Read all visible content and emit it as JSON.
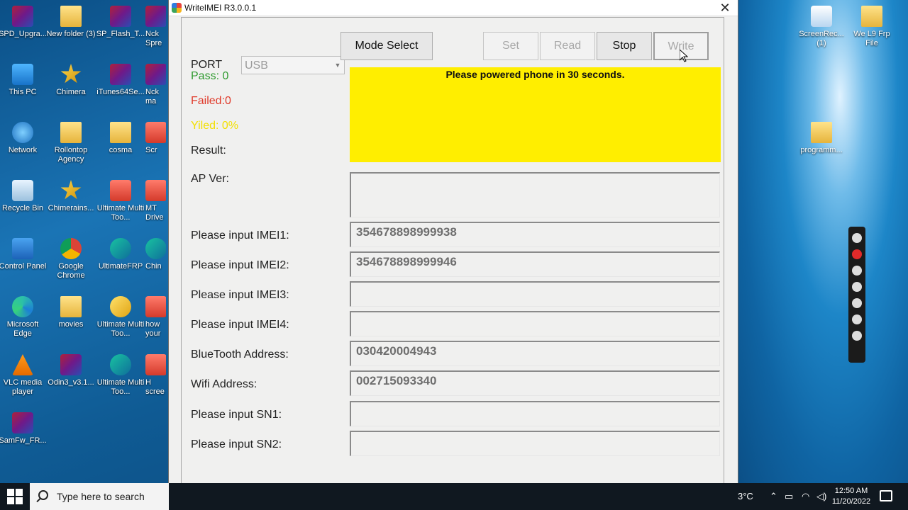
{
  "desktop": {
    "icons": [
      {
        "label": "SPD_Upgra...",
        "type": "rar"
      },
      {
        "label": "New folder (3)",
        "type": "folder"
      },
      {
        "label": "SP_Flash_T...",
        "type": "rar"
      },
      {
        "label": "Nck Spre",
        "type": "rar"
      },
      {
        "label": "This PC",
        "type": "pc"
      },
      {
        "label": "Chimera",
        "type": "star"
      },
      {
        "label": "iTunes64Se...",
        "type": "rar"
      },
      {
        "label": "Nck ma",
        "type": "rar"
      },
      {
        "label": "Network",
        "type": "net"
      },
      {
        "label": "Rollontop Agency",
        "type": "folder"
      },
      {
        "label": "cosma",
        "type": "folder"
      },
      {
        "label": "Scr",
        "type": "app"
      },
      {
        "label": "Recycle Bin",
        "type": "bin"
      },
      {
        "label": "Chimerains...",
        "type": "star"
      },
      {
        "label": "Ultimate Multi Too...",
        "type": "app"
      },
      {
        "label": "MT Drive",
        "type": "app"
      },
      {
        "label": "Control Panel",
        "type": "cp"
      },
      {
        "label": "Google Chrome",
        "type": "chrome"
      },
      {
        "label": "UltimateFRP",
        "type": "frp"
      },
      {
        "label": "Chin",
        "type": "frp"
      },
      {
        "label": "Microsoft Edge",
        "type": "edge"
      },
      {
        "label": "movies",
        "type": "folder"
      },
      {
        "label": "Ultimate Multi Too...",
        "type": "umt"
      },
      {
        "label": "how your",
        "type": "app"
      },
      {
        "label": "VLC media player",
        "type": "vlc"
      },
      {
        "label": "Odin3_v3.1...",
        "type": "rar"
      },
      {
        "label": "Ultimate Multi Too...",
        "type": "frp"
      },
      {
        "label": "H scree",
        "type": "app"
      },
      {
        "label": "SamFw_FR...",
        "type": "rar"
      }
    ],
    "right_icons": [
      {
        "label": "ScreenRec... (1)",
        "type": "rec"
      },
      {
        "label": "We L9 Frp File",
        "type": "folder"
      },
      {
        "label": "programm...",
        "type": "folder"
      }
    ]
  },
  "window": {
    "title": "WriteIMEI R3.0.0.1",
    "close": "✕"
  },
  "toolbar": {
    "port_label": "PORT",
    "port_value": "USB",
    "mode_select": "Mode Select",
    "set": "Set",
    "read": "Read",
    "stop": "Stop",
    "write": "Write"
  },
  "stats": {
    "pass": "Pass:  0",
    "failed": "Failed:0",
    "yield": "Yiled:  0%",
    "result": "Result:"
  },
  "colors": {
    "pass": "#2e9a2e",
    "failed": "#e03a2a",
    "yield": "#f3e000",
    "status_bg": "#ffee00"
  },
  "status": {
    "message": "Please powered phone in 30 seconds."
  },
  "fields": {
    "ap_ver": {
      "label": "AP Ver:",
      "value": ""
    },
    "imei1": {
      "label": "Please input IMEI1:",
      "value": "354678898999938"
    },
    "imei2": {
      "label": "Please input IMEI2:",
      "value": "354678898999946"
    },
    "imei3": {
      "label": "Please input IMEI3:",
      "value": ""
    },
    "imei4": {
      "label": "Please input IMEI4:",
      "value": ""
    },
    "bt": {
      "label": "BlueTooth Address:",
      "value": "030420004943"
    },
    "wifi": {
      "label": "Wifi Address:",
      "value": "002715093340"
    },
    "sn1": {
      "label": "Please input SN1:",
      "value": ""
    },
    "sn2": {
      "label": "Please input SN2:",
      "value": ""
    }
  },
  "taskbar": {
    "search_placeholder": "Type here to search",
    "temp": "3°C",
    "time": "12:50 AM",
    "date": "11/20/2022"
  }
}
